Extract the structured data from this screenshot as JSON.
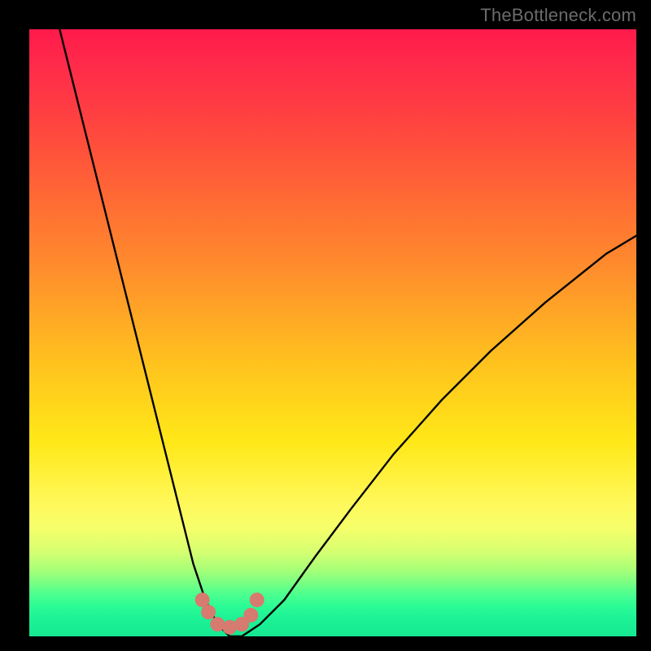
{
  "watermark": "TheBottleneck.com",
  "chart_data": {
    "type": "line",
    "title": "",
    "xlabel": "",
    "ylabel": "",
    "xlim": [
      0,
      100
    ],
    "ylim": [
      0,
      100
    ],
    "grid": false,
    "series": [
      {
        "name": "curve",
        "x": [
          5,
          10,
          15,
          20,
          25,
          27,
          29,
          31,
          33,
          35,
          38,
          42,
          47,
          53,
          60,
          68,
          76,
          85,
          95,
          100
        ],
        "values": [
          100,
          80,
          60,
          40,
          20,
          12,
          6,
          2,
          0,
          0,
          2,
          6,
          13,
          21,
          30,
          39,
          47,
          55,
          63,
          66
        ]
      }
    ],
    "markers": [
      {
        "x": 28.5,
        "y": 6.0
      },
      {
        "x": 29.5,
        "y": 4.0
      },
      {
        "x": 31.0,
        "y": 2.0
      },
      {
        "x": 33.0,
        "y": 1.5
      },
      {
        "x": 35.0,
        "y": 2.0
      },
      {
        "x": 36.5,
        "y": 3.5
      },
      {
        "x": 37.5,
        "y": 6.0
      }
    ],
    "background": {
      "type": "vertical-gradient",
      "stops": [
        {
          "pct": 0,
          "color": "#ff1a4b"
        },
        {
          "pct": 15,
          "color": "#ff4240"
        },
        {
          "pct": 40,
          "color": "#ff8f2c"
        },
        {
          "pct": 68,
          "color": "#ffe818"
        },
        {
          "pct": 86,
          "color": "#d6ff70"
        },
        {
          "pct": 100,
          "color": "#16e892"
        }
      ]
    }
  }
}
